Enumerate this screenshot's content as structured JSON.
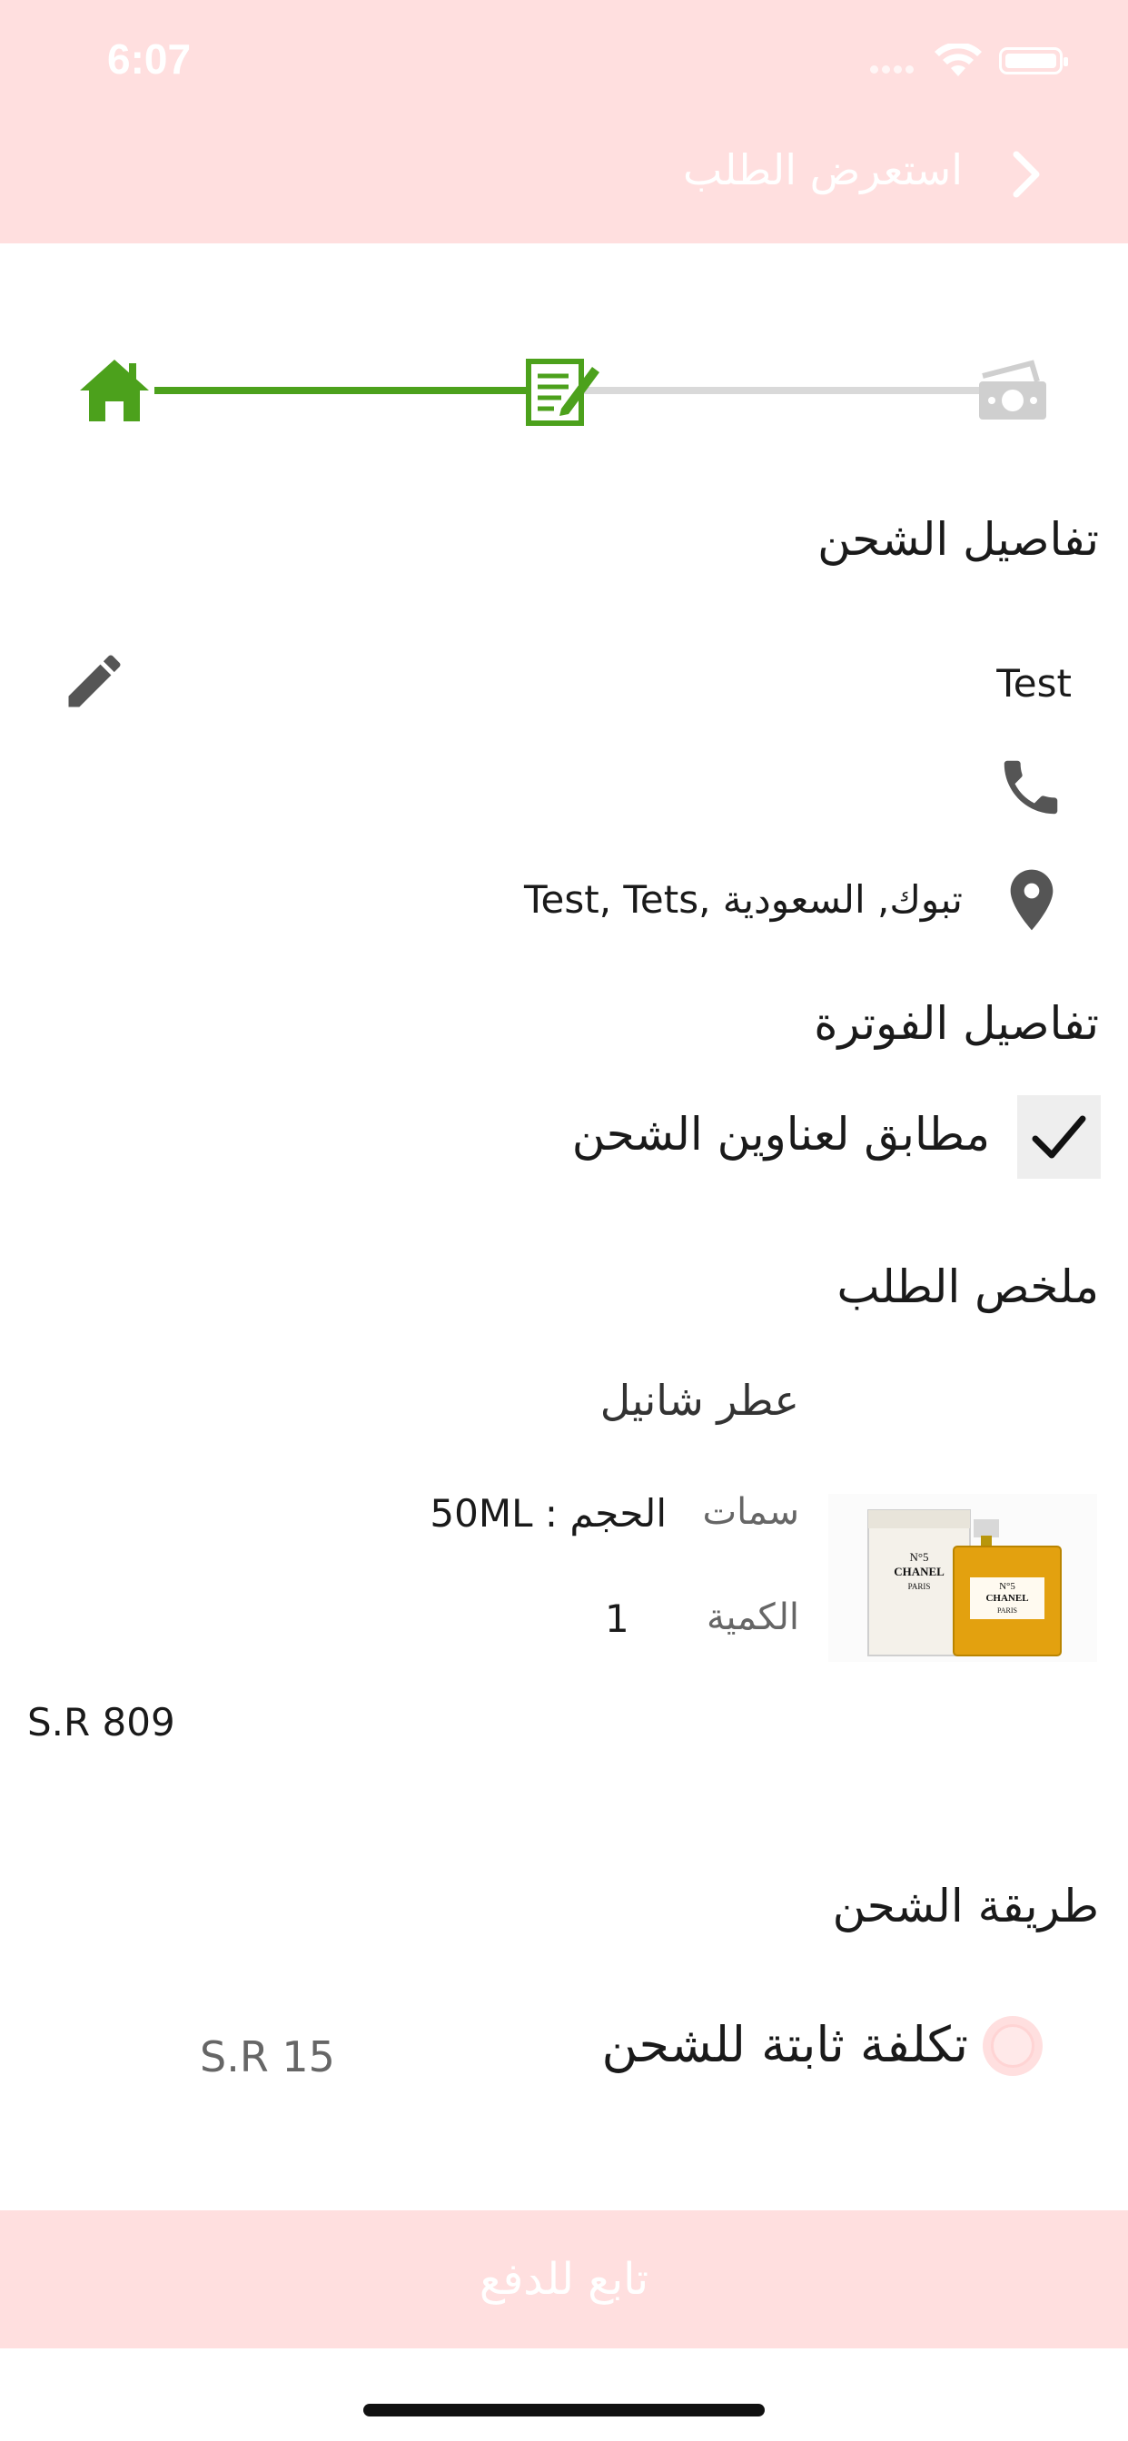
{
  "status_bar": {
    "time": "6:07"
  },
  "header": {
    "title": "استعرض الطلب"
  },
  "shipping_details": {
    "title": "تفاصيل الشحن",
    "name": "Test",
    "address": "تبوك, السعودية ,Test, Tets"
  },
  "billing_details": {
    "title": "تفاصيل الفوترة",
    "same_as_shipping_label": "مطابق لعناوين الشحن",
    "same_as_shipping_checked": true
  },
  "order_summary": {
    "title": "ملخص الطلب",
    "item": {
      "name": "عطر شانيل",
      "attributes_label": "سمات",
      "attributes_value": "الحجم : 50ML",
      "quantity_label": "الكمية",
      "quantity_value": "1",
      "price": "S.R 809",
      "image_caption_line1": "N°5",
      "image_caption_line2": "CHANEL",
      "image_caption_line3": "PARIS"
    }
  },
  "shipping_method": {
    "title": "طريقة الشحن",
    "option_label": "تكلفة ثابتة للشحن",
    "option_price": "S.R 15"
  },
  "footer": {
    "pay_button_label": "تابع للدفع"
  },
  "colors": {
    "header_bg": "#ffdfdf",
    "step_done": "#4ca11c",
    "step_todo": "#d9d9d9",
    "icon_gray": "#555555"
  }
}
